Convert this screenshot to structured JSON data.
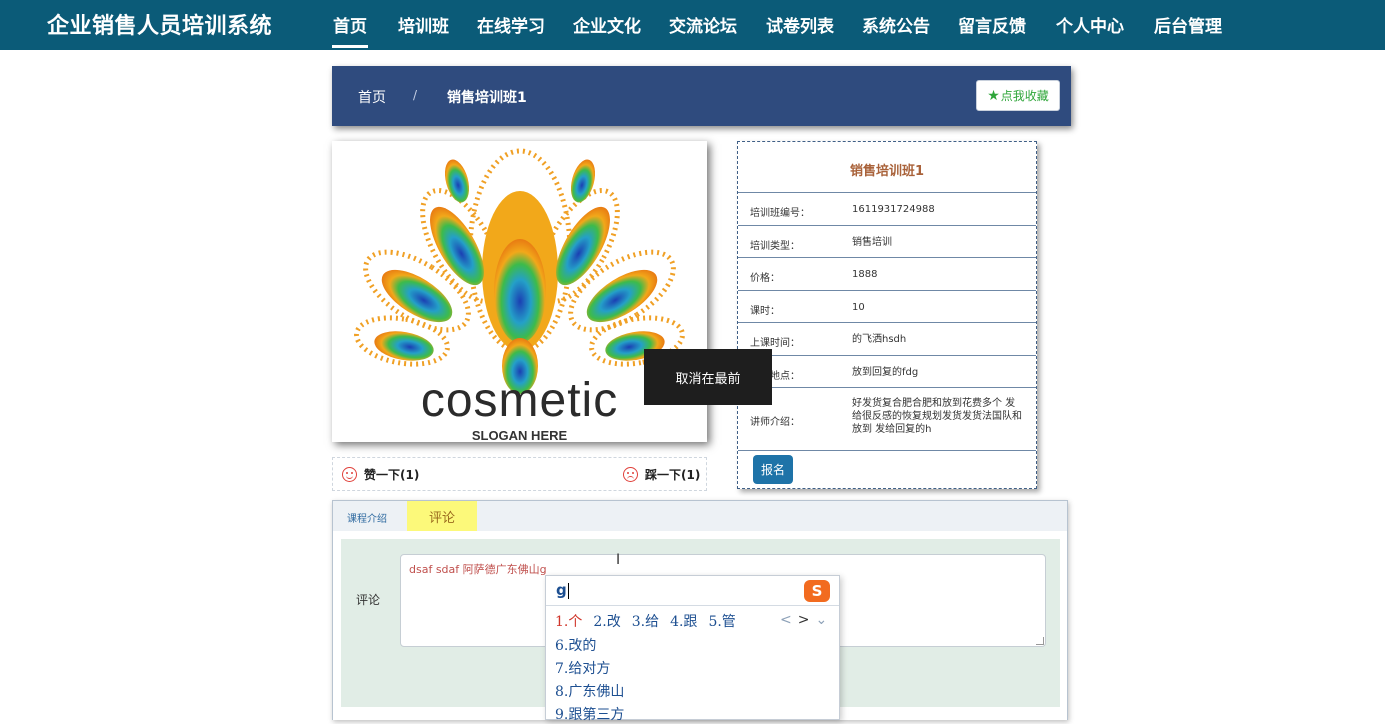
{
  "nav": {
    "brand": "企业销售人员培训系统",
    "items": [
      "首页",
      "培训班",
      "在线学习",
      "企业文化",
      "交流论坛",
      "试卷列表",
      "系统公告",
      "留言反馈",
      "个人中心",
      "后台管理"
    ],
    "active": "首页"
  },
  "breadcrumb": {
    "home": "首页",
    "separator": "/",
    "current": "销售培训班1"
  },
  "favorite": {
    "icon": "star-icon",
    "label": "点我收藏"
  },
  "image": {
    "brand_text": "cosmetic",
    "slogan_text": "SLOGAN HERE"
  },
  "likes": {
    "like_label": "赞一下(1)",
    "dislike_label": "踩一下(1)"
  },
  "info": {
    "title": "销售培训班1",
    "rows": [
      {
        "key": "培训班编号：",
        "value": "1611931724988"
      },
      {
        "key": "培训类型：",
        "value": "销售培训"
      },
      {
        "key": "价格：",
        "value": "1888"
      },
      {
        "key": "课时：",
        "value": "10"
      },
      {
        "key": "上课时间：",
        "value": "的飞洒hsdh"
      },
      {
        "key": "上课地点：",
        "value": "放到回复的fdg"
      },
      {
        "key": "讲师介绍：",
        "value": "好发货复合肥合肥和放到花费多个 发给很反感的恢复规划发货发货法国队和放到 发给回复的h"
      }
    ],
    "signup_label": "报名"
  },
  "tabs": {
    "items": [
      "课程介绍",
      "评论"
    ],
    "active": "评论"
  },
  "comment": {
    "label": "评论",
    "text": "dsaf sdaf 阿萨德广东佛山g"
  },
  "tooltip": {
    "text": "取消在最前"
  },
  "ime": {
    "input": "g",
    "logo": "S",
    "candidates": [
      "1.个",
      "2.改",
      "3.给",
      "4.跟",
      "5.管"
    ],
    "list": [
      "6.改的",
      "7.给对方",
      "8.广东佛山",
      "9.跟第三方"
    ],
    "arrows": [
      "<",
      ">",
      "⌄"
    ]
  },
  "colors": {
    "nav_bg": "#0b5b78",
    "crumb_bg": "#2f4b7e",
    "accent_green": "#2fa63a",
    "title_brown": "#a9623a",
    "signup_blue": "#1e73a8",
    "tab_active_bg": "#fcf97a",
    "form_bg": "#e1ede6",
    "ime_logo": "#f26b1f"
  }
}
